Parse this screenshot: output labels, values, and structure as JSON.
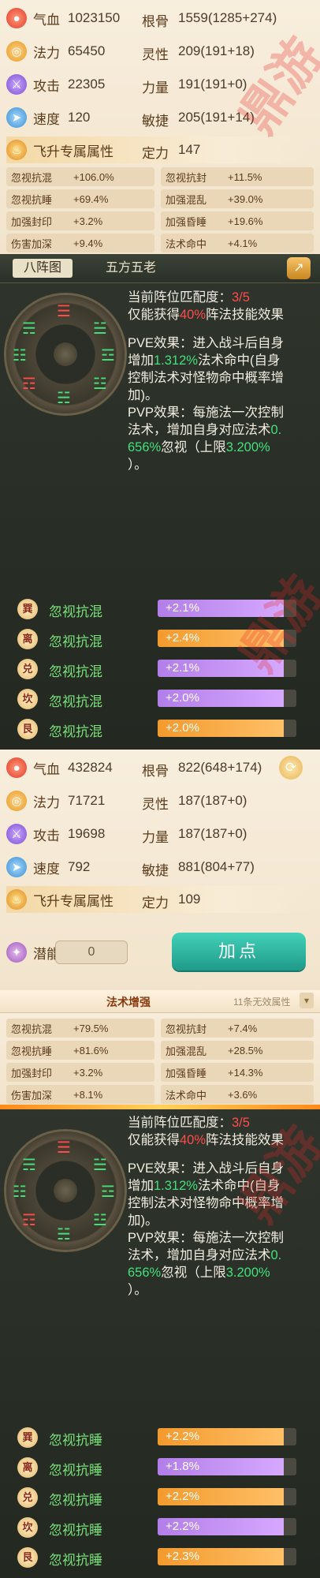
{
  "panel1": {
    "stats_left": [
      {
        "label": "气血",
        "value": "1023150",
        "icon": "hp-drop-icon"
      },
      {
        "label": "法力",
        "value": "65450",
        "icon": "mana-swirl-icon"
      },
      {
        "label": "攻击",
        "value": "22305",
        "icon": "sword-icon"
      },
      {
        "label": "速度",
        "value": "120",
        "icon": "boot-icon"
      }
    ],
    "stats_right": [
      {
        "label": "根骨",
        "value": "1559(1285+274)"
      },
      {
        "label": "灵性",
        "value": "209(191+18)"
      },
      {
        "label": "力量",
        "value": "191(191+0)"
      },
      {
        "label": "敏捷",
        "value": "205(191+14)"
      }
    ],
    "fly_label": "飞升专属属性",
    "ding_label": "定力",
    "ding_value": "147",
    "grid": [
      {
        "label": "忽视抗混",
        "value": "+106.0%"
      },
      {
        "label": "忽视抗封",
        "value": "+11.5%"
      },
      {
        "label": "忽视抗睡",
        "value": "+69.4%"
      },
      {
        "label": "加强混乱",
        "value": "+39.0%"
      },
      {
        "label": "加强封印",
        "value": "+3.2%"
      },
      {
        "label": "加强昏睡",
        "value": "+19.6%"
      },
      {
        "label": "伤害加深",
        "value": "+9.4%"
      },
      {
        "label": "法术命中",
        "value": "+4.1%"
      }
    ]
  },
  "formation1": {
    "tabs": [
      "八阵图",
      "五方五老"
    ],
    "lines": [
      {
        "pre": "当前阵位匹配度：",
        "hl": "3/5",
        "post": ""
      },
      {
        "pre": "仅能获得",
        "hl": "40%",
        "post": "阵法技能效果"
      }
    ],
    "pve": [
      "PVE效果：进入战斗后自身",
      "增加",
      "1.312%",
      "法术命中(自身",
      "控制法术对怪物命中概率增",
      "加)。"
    ],
    "pvp": [
      "PVP效果：每施法一次控制",
      "法术，增加自身对应法术",
      "0.",
      "656%",
      "忽视（上限",
      "3.200%",
      "）。"
    ],
    "bonuses": [
      {
        "trigram": "巽",
        "name": "忽视抗混",
        "value": "+2.1%",
        "color": "purple"
      },
      {
        "trigram": "离",
        "name": "忽视抗混",
        "value": "+2.4%",
        "color": "orange"
      },
      {
        "trigram": "兑",
        "name": "忽视抗混",
        "value": "+2.1%",
        "color": "purple"
      },
      {
        "trigram": "坎",
        "name": "忽视抗混",
        "value": "+2.0%",
        "color": "purple"
      },
      {
        "trigram": "艮",
        "name": "忽视抗混",
        "value": "+2.0%",
        "color": "orange"
      }
    ]
  },
  "panel2": {
    "stats_left": [
      {
        "label": "气血",
        "value": "432824"
      },
      {
        "label": "法力",
        "value": "71721"
      },
      {
        "label": "攻击",
        "value": "19698"
      },
      {
        "label": "速度",
        "value": "792"
      }
    ],
    "stats_right": [
      {
        "label": "根骨",
        "value": "822(648+174)"
      },
      {
        "label": "灵性",
        "value": "187(187+0)"
      },
      {
        "label": "力量",
        "value": "187(187+0)"
      },
      {
        "label": "敏捷",
        "value": "881(804+77)"
      }
    ],
    "fly_label": "飞升专属属性",
    "ding_label": "定力",
    "ding_value": "109",
    "potential_label": "潜能",
    "potential_value": "0",
    "add_button": "加点"
  },
  "panel3": {
    "header": "法术增强",
    "header_right": "11条无效属性",
    "grid": [
      {
        "label": "忽视抗混",
        "value": "+79.5%"
      },
      {
        "label": "忽视抗封",
        "value": "+7.4%"
      },
      {
        "label": "忽视抗睡",
        "value": "+81.6%"
      },
      {
        "label": "加强混乱",
        "value": "+28.5%"
      },
      {
        "label": "加强封印",
        "value": "+3.2%"
      },
      {
        "label": "加强昏睡",
        "value": "+14.3%"
      },
      {
        "label": "伤害加深",
        "value": "+8.1%"
      },
      {
        "label": "法术命中",
        "value": "+3.6%"
      }
    ]
  },
  "formation2": {
    "lines": [
      {
        "pre": "当前阵位匹配度：",
        "hl": "3/5",
        "post": ""
      },
      {
        "pre": "仅能获得",
        "hl": "40%",
        "post": "阵法技能效果"
      }
    ],
    "pve": [
      "PVE效果：进入战斗后自身",
      "增加",
      "1.312%",
      "法术命中(自身",
      "控制法术对怪物命中概率增",
      "加)。"
    ],
    "pvp": [
      "PVP效果：每施法一次控制",
      "法术，增加自身对应法术",
      "0.",
      "656%",
      "忽视（上限",
      "3.200%",
      "）。"
    ],
    "bonuses": [
      {
        "trigram": "巽",
        "name": "忽视抗睡",
        "value": "+2.2%",
        "color": "orange"
      },
      {
        "trigram": "离",
        "name": "忽视抗睡",
        "value": "+1.8%",
        "color": "purple"
      },
      {
        "trigram": "兑",
        "name": "忽视抗睡",
        "value": "+2.2%",
        "color": "orange"
      },
      {
        "trigram": "坎",
        "name": "忽视抗睡",
        "value": "+2.2%",
        "color": "purple"
      },
      {
        "trigram": "艮",
        "name": "忽视抗睡",
        "value": "+2.3%",
        "color": "orange"
      }
    ]
  },
  "watermark": "鼎游"
}
